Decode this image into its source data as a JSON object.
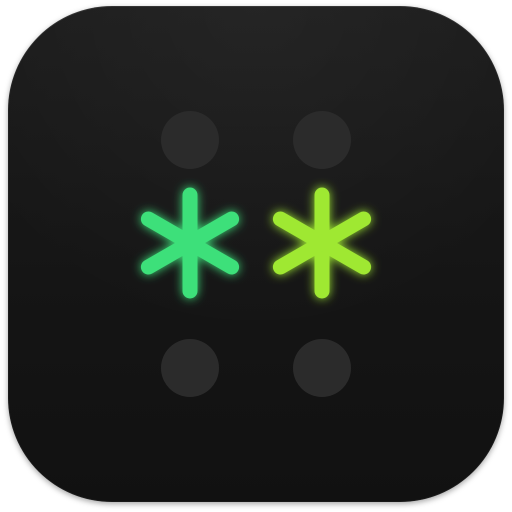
{
  "icon": {
    "name": "app-icon",
    "background_color": "#151515",
    "dot_color": "#2b2b2b",
    "asterisk_left_color": "#3ee07a",
    "asterisk_right_color": "#9fe832",
    "glyphs": [
      "gray-dot",
      "gray-dot",
      "green-asterisk",
      "lime-asterisk",
      "gray-dot",
      "gray-dot"
    ]
  }
}
